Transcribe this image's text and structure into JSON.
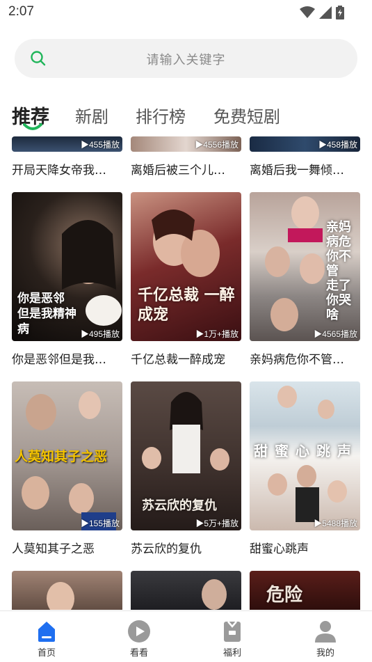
{
  "status": {
    "time": "2:07"
  },
  "search": {
    "placeholder": "请输入关键字"
  },
  "tabs": [
    {
      "label": "推荐",
      "active": true
    },
    {
      "label": "新剧",
      "active": false
    },
    {
      "label": "排行榜",
      "active": false
    },
    {
      "label": "免费短剧",
      "active": false
    }
  ],
  "rows": [
    [
      {
        "title": "开局天降女帝我…",
        "plays": "▶455播放"
      },
      {
        "title": "离婚后被三个儿…",
        "plays": "▶4556播放"
      },
      {
        "title": "离婚后我一舞倾…",
        "plays": "▶458播放"
      }
    ],
    [
      {
        "title": "你是恶邻但是我…",
        "plays": "▶495播放",
        "poster": "你是恶邻 但是我精神病"
      },
      {
        "title": "千亿总裁一醉成宠",
        "plays": "▶1万+播放",
        "poster": "千亿总裁 一醉成宠"
      },
      {
        "title": "亲妈病危你不管…",
        "plays": "▶4565播放",
        "poster": "亲妈病危你不管 走了你哭啥"
      }
    ],
    [
      {
        "title": "人莫知其子之恶",
        "plays": "▶155播放",
        "poster": "人莫知其子之恶"
      },
      {
        "title": "苏云欣的复仇",
        "plays": "▶5万+播放",
        "poster": "苏云欣的复仇"
      },
      {
        "title": "甜蜜心跳声",
        "plays": "▶5488播放",
        "poster": "甜蜜心跳声"
      }
    ],
    [
      {
        "title": "",
        "plays": ""
      },
      {
        "title": "",
        "plays": ""
      },
      {
        "title": "",
        "plays": "",
        "poster": "危险"
      }
    ]
  ],
  "nav": [
    {
      "label": "首页",
      "icon": "home-icon",
      "active": true
    },
    {
      "label": "看看",
      "icon": "play-circle-icon",
      "active": false
    },
    {
      "label": "福利",
      "icon": "gift-icon",
      "active": false
    },
    {
      "label": "我的",
      "icon": "user-icon",
      "active": false
    }
  ],
  "colors": {
    "accent": "#20b55a",
    "nav_active": "#1f6ff0",
    "nav_inactive": "#9a9a9a"
  }
}
